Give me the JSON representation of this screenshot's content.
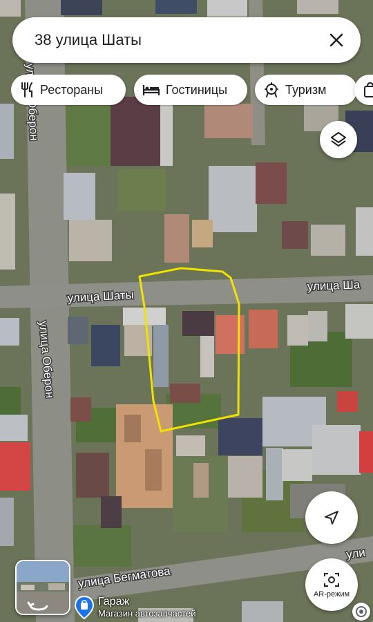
{
  "search": {
    "query": "38 улица Шаты"
  },
  "chips": [
    {
      "label": "Рестораны",
      "icon": "restaurant-icon"
    },
    {
      "label": "Гостиницы",
      "icon": "hotel-icon"
    },
    {
      "label": "Туризм",
      "icon": "attraction-icon"
    }
  ],
  "streets": {
    "oberon_upper": "улица Оберон",
    "oberon_lower": "улица Оберон",
    "shaty_left": "улица Шаты",
    "shaty_right": "улица Ша",
    "begmatova": "улица Бегматова",
    "right_bottom": "ули"
  },
  "poi": {
    "name": "Гараж",
    "subtitle": "Магазин автозапчастей",
    "icon": "shopping-bag-icon"
  },
  "controls": {
    "layers_icon": "layers-icon",
    "navigate_icon": "navigation-arrow-icon",
    "ar_label": "AR-режим"
  },
  "colors": {
    "highlight": "#f2e200",
    "poi_pin": "#1a73e8"
  }
}
